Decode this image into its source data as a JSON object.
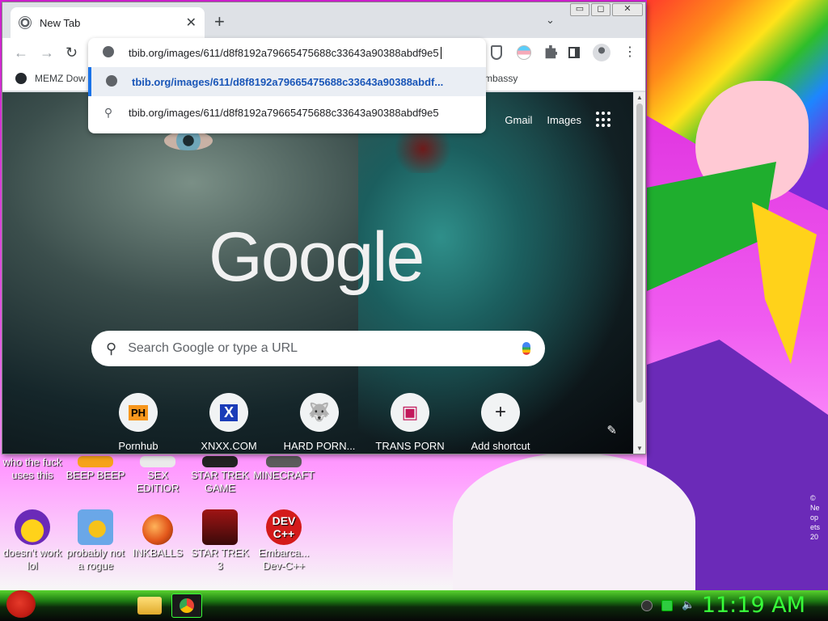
{
  "browser": {
    "tab_title": "New Tab",
    "tab_close": "✕",
    "new_tab": "+",
    "tab_search": "⌄",
    "window_controls": [
      "▭",
      "◻",
      "✕"
    ],
    "address_value": "tbib.org/images/611/d8f8192a79665475688c33643a90388abdf9e5"
  },
  "omnibox": {
    "suggestions": [
      {
        "icon": "globe-icon",
        "text": "tbib.org/images/611/d8f8192a79665475688c33643a90388abdf..."
      },
      {
        "icon": "search-icon",
        "text": "tbib.org/images/611/d8f8192a79665475688c33643a90388abdf9e5"
      }
    ]
  },
  "bookmarks": {
    "items": [
      {
        "label": "MEMZ Dow"
      },
      {
        "label": "mbassy"
      }
    ]
  },
  "ntp": {
    "gmail": "Gmail",
    "images": "Images",
    "logo": "Google",
    "search_placeholder": "Search Google or type a URL",
    "shortcuts": [
      {
        "label": "Pornhub",
        "glyph": "PH"
      },
      {
        "label": "XNXX.COM",
        "glyph": "X"
      },
      {
        "label": "HARD PORN...",
        "glyph": "🐺"
      },
      {
        "label": "TRANS PORN",
        "glyph": "▣"
      },
      {
        "label": "Add shortcut",
        "glyph": "+"
      }
    ],
    "customize": "✎"
  },
  "desktop": {
    "icons": [
      {
        "label": "who the fuck uses this"
      },
      {
        "label": "BEEP BEEP"
      },
      {
        "label": "SEX EDITIOR"
      },
      {
        "label": "STAR TREK GAME"
      },
      {
        "label": "MINECRAFT"
      },
      {
        "label": "doesn't work lol"
      },
      {
        "label": "probably not a rogue"
      },
      {
        "label": "INKBALLS"
      },
      {
        "label": "STAR TREK 3"
      },
      {
        "label": "Embarca... Dev-C++"
      }
    ],
    "wallpaper_credit": "© Neopets 20"
  },
  "taskbar": {
    "clock": "11:19 AM"
  },
  "colors": {
    "taskbar_green": "#38ff3a",
    "wallpaper_magenta": "#e62ee8",
    "omni_highlight": "#1a73e8"
  }
}
